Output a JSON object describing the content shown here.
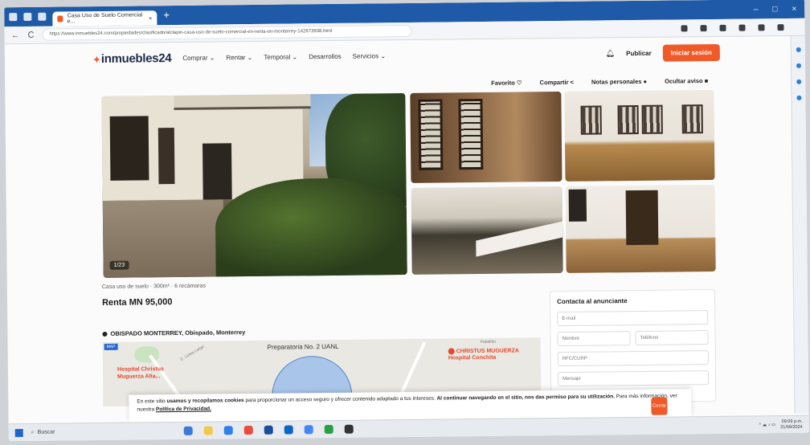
{
  "browser": {
    "tab_title": "Casa Uso de Suelo Comercial e...",
    "tab_close": "×",
    "new_tab": "+",
    "url": "https://www.inmuebles24.com/propiedades/clasificado/alclapin-casa-uso-de-suelo-comercial-en-renta-en-monterrey-142673938.html",
    "back": "←",
    "reload": "C",
    "min": "–",
    "max": "□",
    "close": "×"
  },
  "site": {
    "logo_text": "inmuebles24",
    "menu": [
      "Comprar ⌄",
      "Rentar ⌄",
      "Temporal ⌄",
      "Desarrollos",
      "Servicios ⌄"
    ],
    "publicar": "Publicar",
    "login": "Iniciar sesión"
  },
  "actions": {
    "favorito": "Favorito ♡",
    "compartir": "Compartir <",
    "notas": "Notas personales ●",
    "ocultar": "Ocultar aviso ■"
  },
  "gallery": {
    "photo_count": "1/23"
  },
  "listing": {
    "subtitle": "Casa uso de suelo · 300m² · 6 recámaras",
    "price": "Renta MN 95,000",
    "location": "OBISPADO MONTERREY, Obispado, Monterrey"
  },
  "map": {
    "tag": "MAP",
    "prep": "Preparatoria No. 2 UANL",
    "hospital": "Hospital Christus Muguerza Alta...",
    "christus": "CHRISTUS MUGUERZA",
    "christus_sub": "Hospital Conchita",
    "street": "C. Loma Larga",
    "pablo": "Pabellón"
  },
  "contact": {
    "title": "Contacta al anunciante",
    "email": "E-mail",
    "nombre": "Nombre",
    "telefono": "Teléfono",
    "rfc": "RFC/CURP",
    "mensaje": "Mensaje"
  },
  "cookie": {
    "text_a": "En este sitio ",
    "text_b": "usamos y recopilamos cookies",
    "text_c": " para proporcionar un acceso seguro y ofrecer contenido adaptado a tus intereses. ",
    "text_d": "Al continuar navegando en el sitio, nos das permiso para su utilización.",
    "text_e": " Para más información, ver nuestra ",
    "policy": "Política de Privacidad.",
    "button": "Cerrar"
  },
  "taskbar": {
    "search": "Buscar",
    "time": "09:09 p.m.",
    "date": "21/09/2024",
    "app_colors": [
      "#3c78d8",
      "#f2c94c",
      "#2f80ed",
      "#e74c3c",
      "#1b4f9c",
      "#0a66c2",
      "#4285f4",
      "#25a244",
      "#333333"
    ]
  },
  "colors": {
    "brand": "#f05a28",
    "browser": "#1f5aa8"
  }
}
